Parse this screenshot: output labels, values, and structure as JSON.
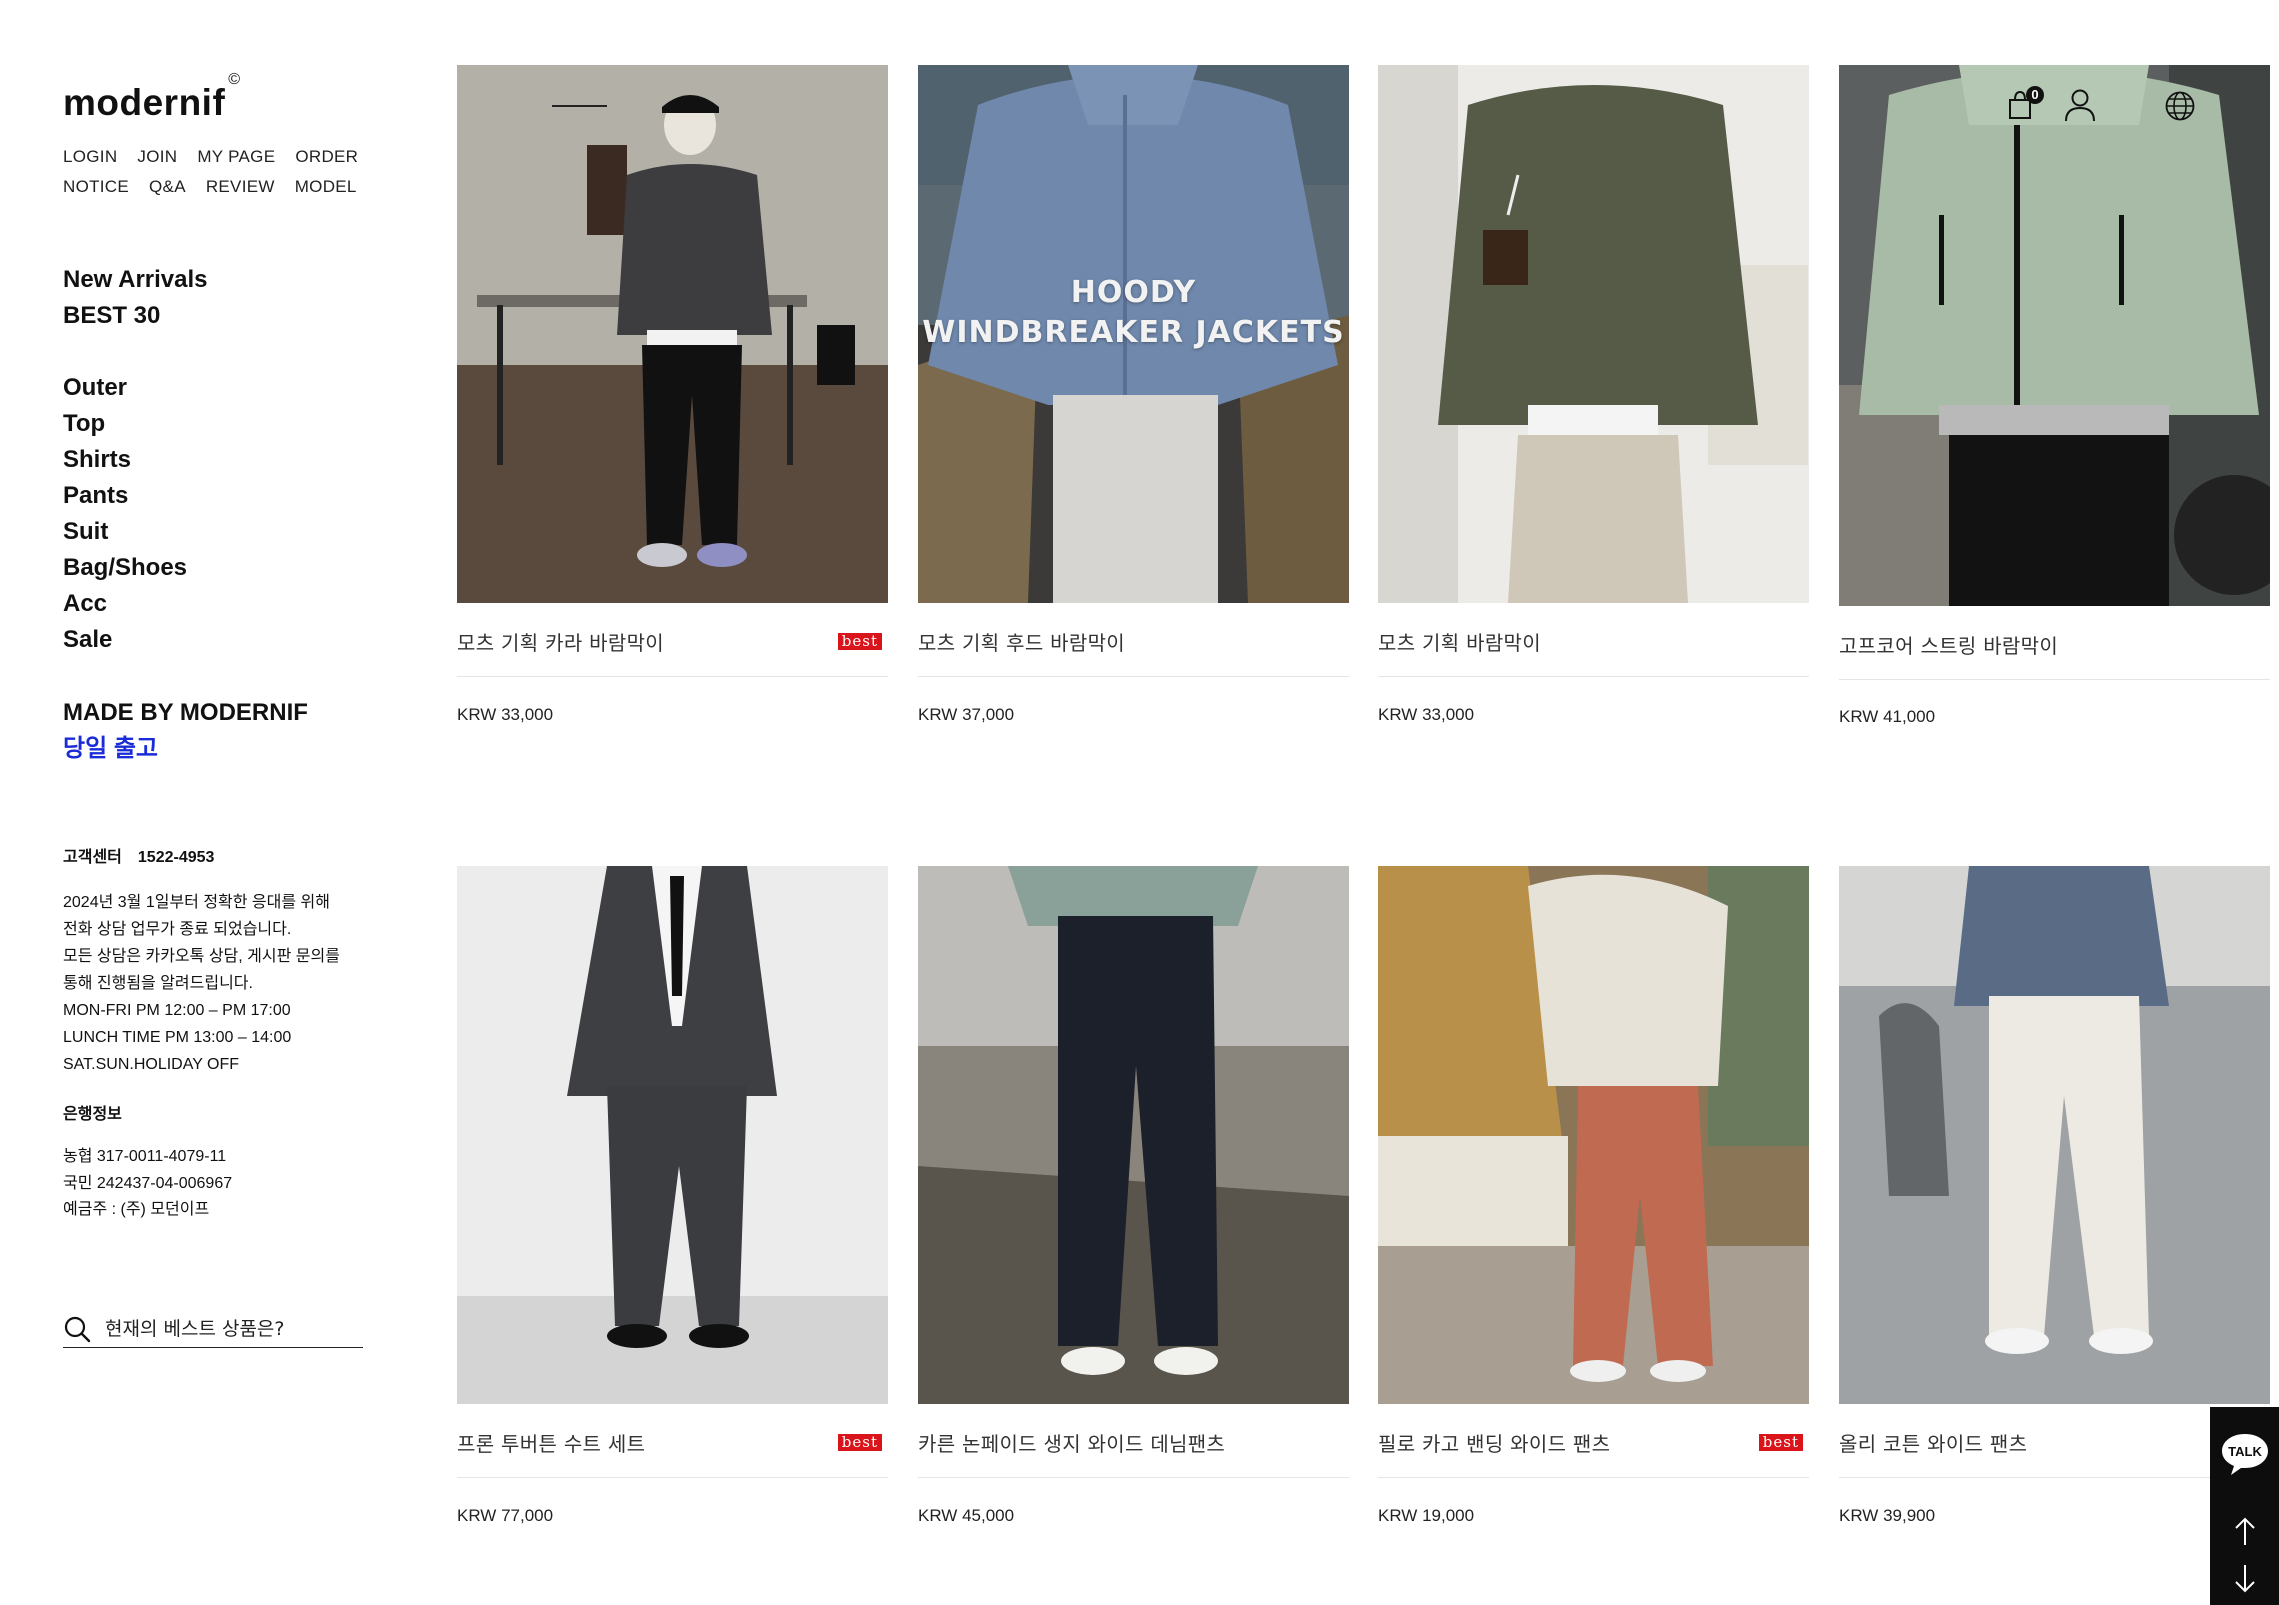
{
  "brand": {
    "logo": "modernif",
    "logo_mark": "©"
  },
  "util_links": [
    "LOGIN",
    "JOIN",
    "MY PAGE",
    "ORDER",
    "NOTICE",
    "Q&A",
    "REVIEW",
    "MODEL"
  ],
  "main_menu": [
    "New Arrivals",
    "BEST 30"
  ],
  "categories": [
    "Outer",
    "Top",
    "Shirts",
    "Pants",
    "Suit",
    "Bag/Shoes",
    "Acc",
    "Sale"
  ],
  "made_by": {
    "label": "MADE BY MODERNIF",
    "same_day": "당일 출고",
    "same_day_color": "#1a2bd8"
  },
  "customer_center": {
    "title": "고객센터",
    "phone": "1522-4953",
    "lines": [
      "2024년 3월 1일부터 정확한 응대를 위해",
      "전화 상담 업무가 종료 되었습니다.",
      "모든 상담은 카카오톡 상담, 게시판 문의를",
      "통해 진행됨을 알려드립니다.",
      "MON-FRI PM 12:00 – PM 17:00",
      "LUNCH TIME PM 13:00 – 14:00",
      "SAT.SUN.HOLIDAY OFF"
    ]
  },
  "bank_info": {
    "title": "은행정보",
    "lines": [
      "농협 317-0011-4079-11",
      "국민 242437-04-006967",
      "예금주 : (주) 모던이프"
    ]
  },
  "search": {
    "placeholder": "현재의 베스트 상품은?",
    "icon": "search-icon"
  },
  "header_icons": {
    "cart_icon": "cart-icon",
    "cart_count": "0",
    "user_icon": "user-icon",
    "globe_icon": "globe-icon"
  },
  "products": [
    {
      "name": "모츠 기획 카라 바람막이",
      "price": "KRW 33,000",
      "badge": "best",
      "image": "model in charcoal collar jacket with black pants in cafe"
    },
    {
      "name": "모츠 기획 후드 바람막이",
      "price": "KRW 37,000",
      "badge": "",
      "image": "blue hooded windbreaker jacket",
      "overlay": [
        "HOODY",
        "WINDBREAKER JACKETS"
      ]
    },
    {
      "name": "모츠 기획 바람막이",
      "price": "KRW 33,000",
      "badge": "",
      "image": "khaki windbreaker with beige pants holding iced drink"
    },
    {
      "name": "고프코어 스트링 바람막이",
      "price": "KRW 41,000",
      "badge": "",
      "image": "mint gorpcore string windbreaker"
    },
    {
      "name": "프론 투버튼 수트 세트",
      "price": "KRW 77,000",
      "badge": "best",
      "image": "charcoal two-button suit with black tie"
    },
    {
      "name": "카른 논페이드 생지 와이드 데님팬츠",
      "price": "KRW 45,000",
      "badge": "",
      "image": "raw indigo wide denim pants with white sneakers"
    },
    {
      "name": "필로 카고 밴딩 와이드 팬츠",
      "price": "KRW 19,000",
      "badge": "best",
      "image": "terracotta cargo wide pants with ivory jacket"
    },
    {
      "name": "올리 코튼 와이드 팬츠",
      "price": "KRW 39,900",
      "badge": "",
      "image": "ivory cotton wide pants with blue knit cardigan"
    }
  ],
  "float_bar": {
    "talk_label": "TALK",
    "up_icon": "arrow-up-icon",
    "down_icon": "arrow-down-icon"
  }
}
